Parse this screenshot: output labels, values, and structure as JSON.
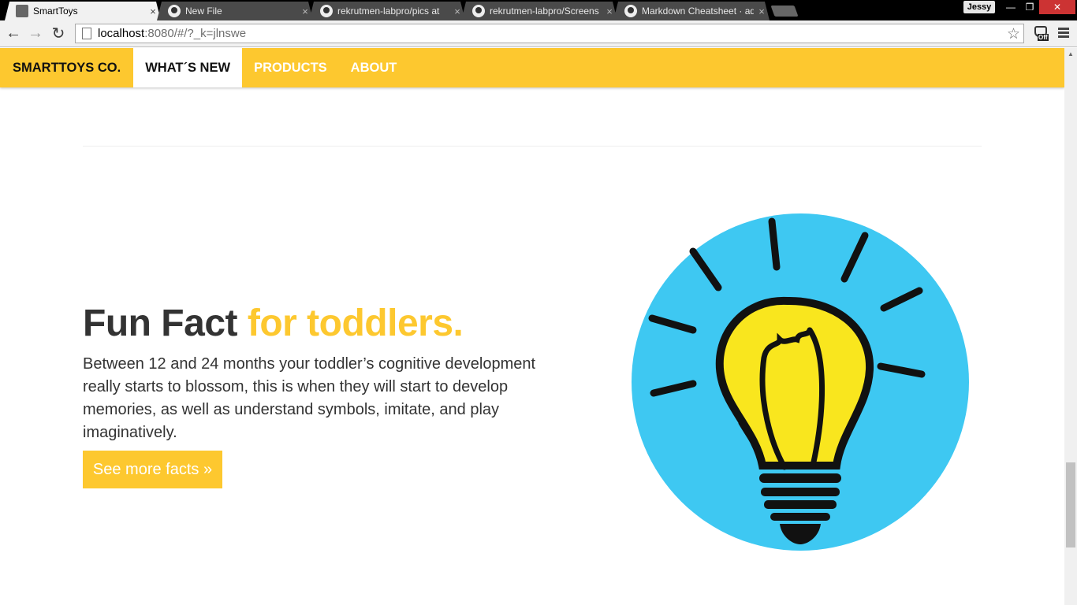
{
  "browser": {
    "tabs": [
      {
        "title": "SmartToys",
        "active": true
      },
      {
        "title": "New File",
        "active": false
      },
      {
        "title": "rekrutmen-labpro/pics at",
        "active": false
      },
      {
        "title": "rekrutmen-labpro/Screens",
        "active": false
      },
      {
        "title": "Markdown Cheatsheet · ad",
        "active": false
      }
    ],
    "close_glyph": "×",
    "user_name": "Jessy",
    "window_controls": [
      "—",
      "❐",
      "✕"
    ],
    "nav_icons": {
      "back": "←",
      "forward": "→",
      "reload": "↻"
    },
    "url_host": "localhost",
    "url_rest": ":8080/#/?_k=jlnswe",
    "star_glyph": "☆",
    "extension_badge": "Off"
  },
  "site": {
    "brand": "SMARTTOYS CO.",
    "nav": [
      "WHAT´S NEW",
      "PRODUCTS",
      "ABOUT"
    ],
    "active_nav": "WHAT´S NEW",
    "accent_color": "#fdc82f"
  },
  "feature": {
    "heading_main": "Fun Fact",
    "heading_accent": "for toddlers.",
    "body": "Between 12 and 24 months your toddler’s cognitive development really starts to blossom, this is when they will start to develop memories, as well as understand symbols, imitate, and play imaginatively.",
    "button_label": "See more facts »",
    "illustration": "lightbulb-icon",
    "illustration_colors": {
      "circle": "#3ec8f2",
      "bulb": "#f9e61e",
      "outline": "#111111"
    }
  }
}
